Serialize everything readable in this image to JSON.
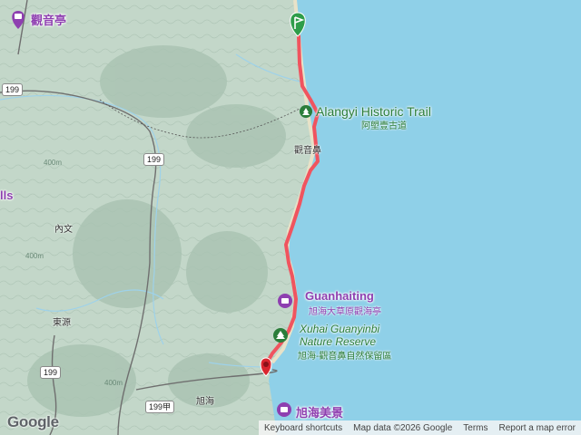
{
  "map": {
    "land_color": "#c3d7c9",
    "ocean_color": "#8fd0e8",
    "route_color": "#f0545f",
    "pois": [
      {
        "name": "觀音亭",
        "type": "purple"
      },
      {
        "name": "Alangyi Historic Trail",
        "name_zh": "阿塱壹古道",
        "type": "green"
      },
      {
        "name": "Guanhaiting",
        "name_zh": "旭海大草原觀海亭",
        "type": "purple"
      },
      {
        "name": "Xuhai Guanyinbi",
        "name_line2": "Nature Reserve",
        "name_zh": "旭海-觀音鼻自然保留區",
        "type": "green"
      },
      {
        "name": "旭海美景",
        "type": "purple"
      }
    ],
    "places": [
      "內文",
      "東源",
      "旭海",
      "觀音鼻",
      "lls"
    ],
    "road_shields": [
      "199",
      "199",
      "199",
      "199甲"
    ],
    "contours": [
      "400m",
      "400m",
      "400m"
    ],
    "markers": {
      "start": "start-flag",
      "end": "end-pin"
    }
  },
  "footer": {
    "logo": "Google",
    "keyboard_shortcuts": "Keyboard shortcuts",
    "map_data": "Map data ©2026 Google",
    "terms": "Terms",
    "report": "Report a map error"
  }
}
